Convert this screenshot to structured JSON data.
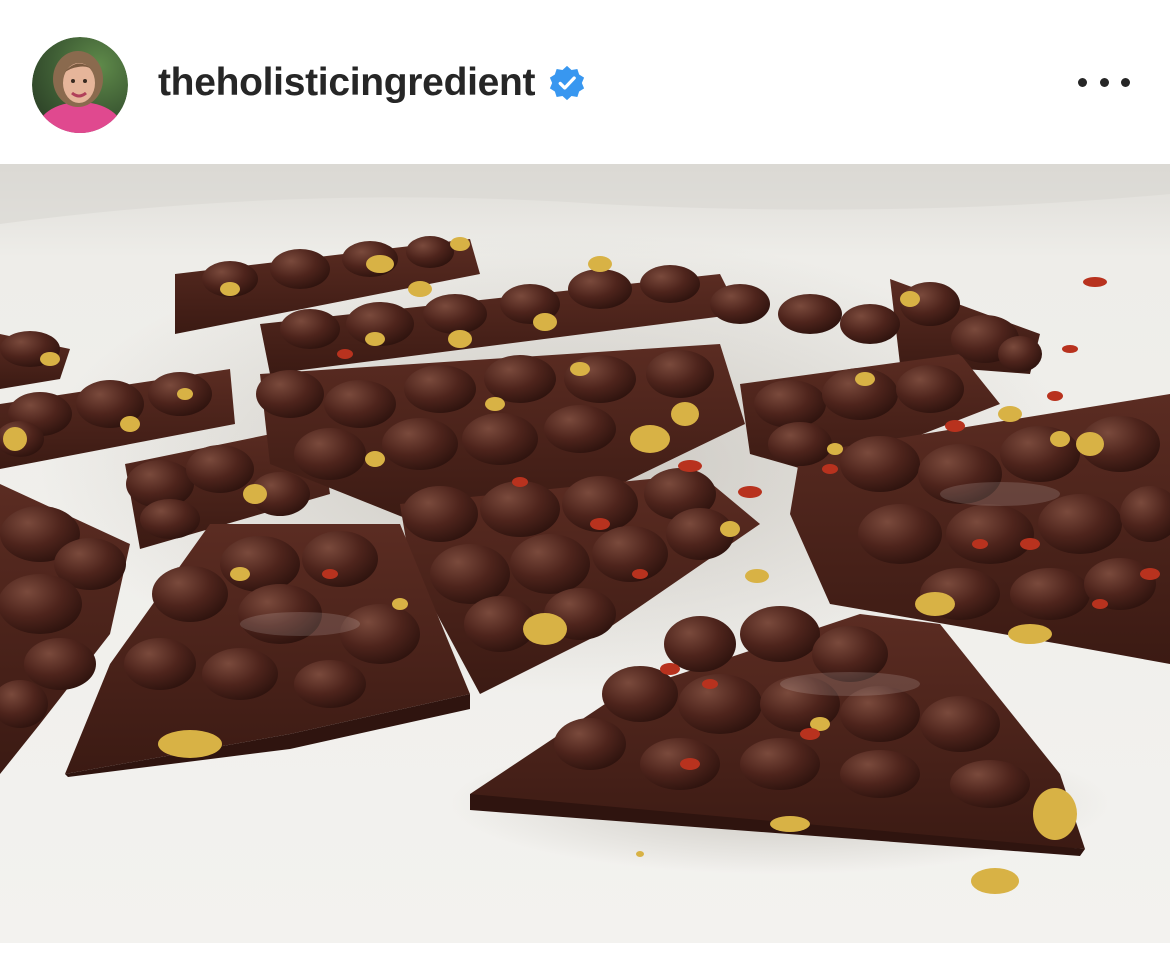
{
  "post": {
    "username": "theholisticingredient",
    "verified": true,
    "verified_color": "#3897f0",
    "avatar_icon": "profile-photo",
    "more_icon": "more-horizontal-icon"
  },
  "photo": {
    "subject": "chocolate bark pieces with nuts and chili flakes on parchment paper",
    "colors": {
      "parchment": "#ecebe7",
      "chocolate": "#4a231c",
      "nut": "#d8b245",
      "chili": "#b8321e"
    }
  }
}
